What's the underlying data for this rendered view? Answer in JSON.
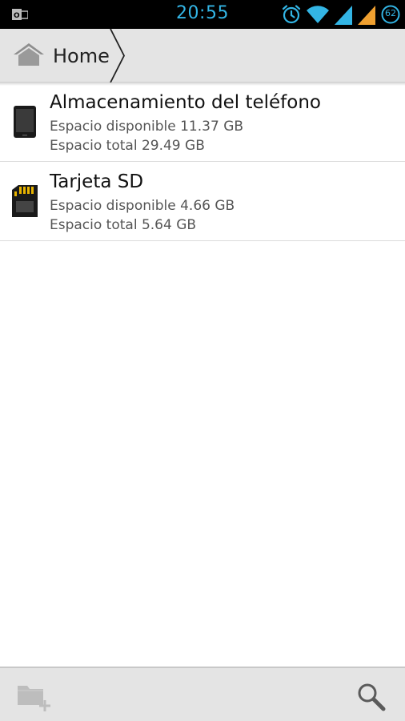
{
  "status_bar": {
    "time": "20:55",
    "battery_level": "62",
    "icons": [
      "outlook-notification-icon",
      "alarm-icon",
      "wifi-icon",
      "signal-icon",
      "signal-icon",
      "battery-icon"
    ],
    "accent_color": "#33b5e5",
    "signal_secondary_color": "#f0a030"
  },
  "breadcrumb": {
    "home_label": "Home",
    "home_icon": "home-icon"
  },
  "storage_list": [
    {
      "icon": "phone-icon",
      "title": "Almacenamiento del teléfono",
      "available": "Espacio disponible 11.37 GB",
      "total": "Espacio total 29.49 GB"
    },
    {
      "icon": "sd-card-icon",
      "title": "Tarjeta SD",
      "available": "Espacio disponible 4.66 GB",
      "total": "Espacio total 5.64 GB"
    }
  ],
  "bottom_bar": {
    "new_folder_icon": "new-folder-icon",
    "new_folder_enabled": false,
    "search_icon": "search-icon"
  }
}
